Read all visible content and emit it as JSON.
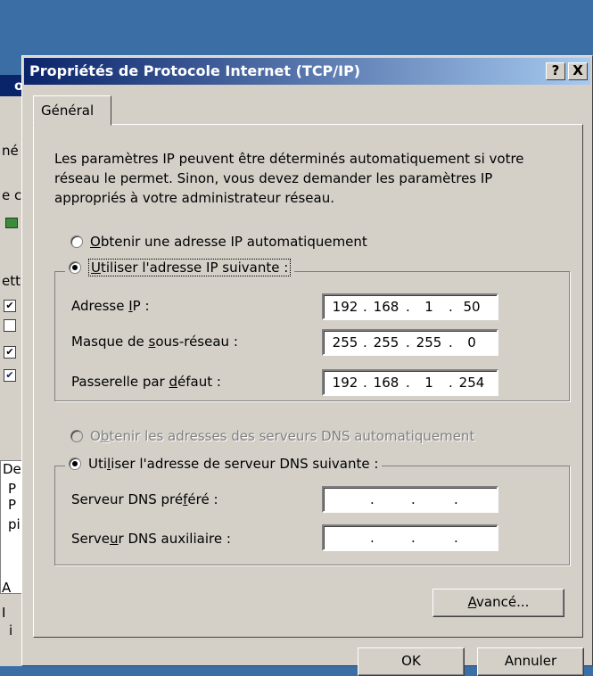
{
  "background_window": {
    "fragments": [
      "op",
      "né",
      "e c",
      "ett",
      "De",
      "P",
      "P",
      "pi",
      "A",
      "I",
      "i"
    ]
  },
  "dialog": {
    "title": "Propriétés de Protocole Internet (TCP/IP)",
    "help_button": "?",
    "close_button": "X",
    "tab": "Général",
    "description_lines": [
      "Les paramètres IP peuvent être déterminés automatiquement si votre",
      "réseau le permet. Sinon, vous devez demander les paramètres IP",
      "appropriés à votre administrateur réseau."
    ],
    "ip_mode": {
      "auto": {
        "pre": "",
        "key": "O",
        "post": "btenir une adresse IP automatiquement",
        "checked": false
      },
      "manual": {
        "pre": "",
        "key": "U",
        "post": "tiliser l'adresse IP suivante :",
        "checked": true
      }
    },
    "ip_fields": {
      "address": {
        "pre": "Adresse ",
        "key": "I",
        "post": "P :",
        "octets": [
          "192",
          "168",
          "1",
          "50"
        ]
      },
      "mask": {
        "pre": "Masque de ",
        "key": "s",
        "post": "ous-réseau :",
        "octets": [
          "255",
          "255",
          "255",
          "0"
        ]
      },
      "gateway": {
        "pre": "Passerelle par ",
        "key": "d",
        "post": "éfaut :",
        "octets": [
          "192",
          "168",
          "1",
          "254"
        ]
      }
    },
    "dns_mode": {
      "auto": {
        "pre": "O",
        "key": "b",
        "post": "tenir les adresses des serveurs DNS automatiquement",
        "checked": false,
        "disabled": true
      },
      "manual": {
        "pre": "Uti",
        "key": "l",
        "post": "iser l'adresse de serveur DNS suivante :",
        "checked": true
      }
    },
    "dns_fields": {
      "preferred": {
        "pre": "Serveur DNS pré",
        "key": "f",
        "post": "éré :",
        "octets": [
          "",
          "",
          "",
          ""
        ]
      },
      "alternate": {
        "pre": "Serve",
        "key": "u",
        "post": "r DNS auxiliaire :",
        "octets": [
          "",
          "",
          "",
          ""
        ]
      }
    },
    "advanced_button": {
      "key": "A",
      "post": "vancé..."
    },
    "ok_button": "OK",
    "cancel_button": "Annuler"
  },
  "colors": {
    "desktop": "#3a6ea5",
    "title_start": "#0a246a",
    "title_end": "#a6caf0",
    "face": "#d4d0c8"
  }
}
